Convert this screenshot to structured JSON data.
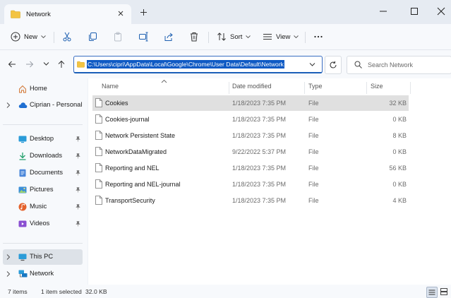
{
  "window": {
    "tab_title": "Network",
    "icons": {
      "tab": "folder-icon",
      "close_tab": "close-icon",
      "new_tab": "plus-icon",
      "minimize": "minimize-icon",
      "maximize": "maximize-icon",
      "close": "close-icon"
    }
  },
  "toolbar": {
    "new_label": "New",
    "sort_label": "Sort",
    "view_label": "View",
    "icons": [
      "cut-icon",
      "copy-icon",
      "paste-icon",
      "rename-icon",
      "share-icon",
      "delete-icon",
      "more-icon"
    ]
  },
  "address": {
    "path": "C:\\Users\\cipri\\AppData\\Local\\Google\\Chrome\\User Data\\Default\\Network",
    "search_placeholder": "Search Network"
  },
  "sidebar": {
    "items": [
      {
        "label": "Home",
        "icon": "home-icon"
      },
      {
        "label": "Ciprian - Personal",
        "icon": "cloud-icon"
      },
      {
        "label": "Desktop",
        "icon": "desktop-icon",
        "pinned": true
      },
      {
        "label": "Downloads",
        "icon": "download-icon",
        "pinned": true
      },
      {
        "label": "Documents",
        "icon": "documents-icon",
        "pinned": true
      },
      {
        "label": "Pictures",
        "icon": "pictures-icon",
        "pinned": true
      },
      {
        "label": "Music",
        "icon": "music-icon",
        "pinned": true
      },
      {
        "label": "Videos",
        "icon": "videos-icon",
        "pinned": true
      },
      {
        "label": "This PC",
        "icon": "computer-icon",
        "selected": true
      },
      {
        "label": "Network",
        "icon": "network-icon"
      }
    ]
  },
  "columns": {
    "name": "Name",
    "date": "Date modified",
    "type": "Type",
    "size": "Size"
  },
  "files": [
    {
      "name": "Cookies",
      "date": "1/18/2023 7:35 PM",
      "type": "File",
      "size": "32 KB",
      "selected": true
    },
    {
      "name": "Cookies-journal",
      "date": "1/18/2023 7:35 PM",
      "type": "File",
      "size": "0 KB"
    },
    {
      "name": "Network Persistent State",
      "date": "1/18/2023 7:35 PM",
      "type": "File",
      "size": "8 KB"
    },
    {
      "name": "NetworkDataMigrated",
      "date": "9/22/2022 5:37 PM",
      "type": "File",
      "size": "0 KB"
    },
    {
      "name": "Reporting and NEL",
      "date": "1/18/2023 7:35 PM",
      "type": "File",
      "size": "56 KB"
    },
    {
      "name": "Reporting and NEL-journal",
      "date": "1/18/2023 7:35 PM",
      "type": "File",
      "size": "0 KB"
    },
    {
      "name": "TransportSecurity",
      "date": "1/18/2023 7:35 PM",
      "type": "File",
      "size": "4 KB"
    }
  ],
  "status": {
    "items_count": "7 items",
    "selection": "1 item selected",
    "selection_size": "32.0 KB"
  },
  "colors": {
    "accent": "#0f5ac4",
    "folder": "#f3c443",
    "selected_row": "#e0e0e0"
  }
}
